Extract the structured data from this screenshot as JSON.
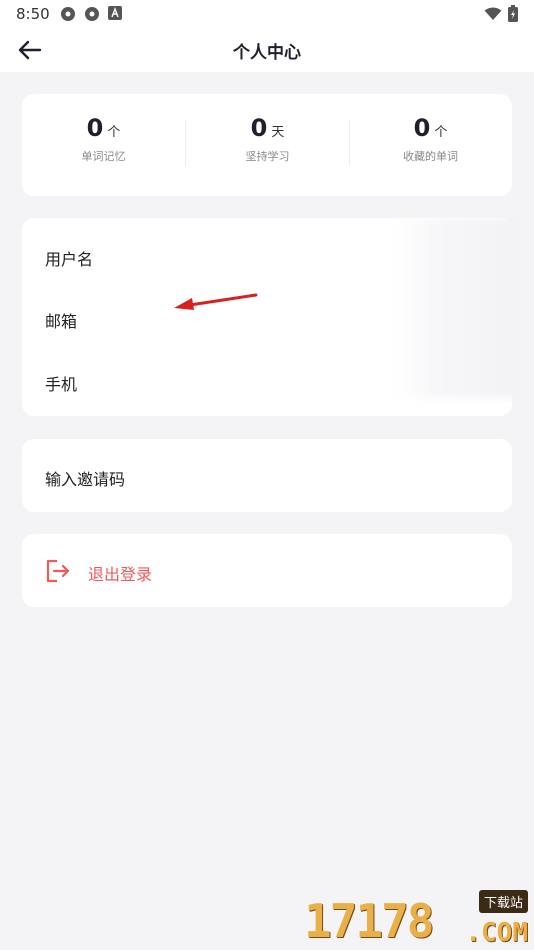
{
  "status_bar": {
    "time": "8:50"
  },
  "header": {
    "title": "个人中心"
  },
  "stats": [
    {
      "value": "0",
      "unit": "个",
      "label": "单词记忆"
    },
    {
      "value": "0",
      "unit": "天",
      "label": "坚持学习"
    },
    {
      "value": "0",
      "unit": "个",
      "label": "收藏的单词"
    }
  ],
  "profile": {
    "username_label": "用户名",
    "email_label": "邮箱",
    "phone_label": "手机"
  },
  "invite": {
    "label": "输入邀请码"
  },
  "logout": {
    "label": "退出登录"
  },
  "watermark": {
    "digits": "17178",
    "tag": "下载站",
    "com": ".COM"
  },
  "colors": {
    "background": "#f4f4f6",
    "card": "#ffffff",
    "danger": "#ef5b5b",
    "annotation_arrow": "#d92020"
  }
}
